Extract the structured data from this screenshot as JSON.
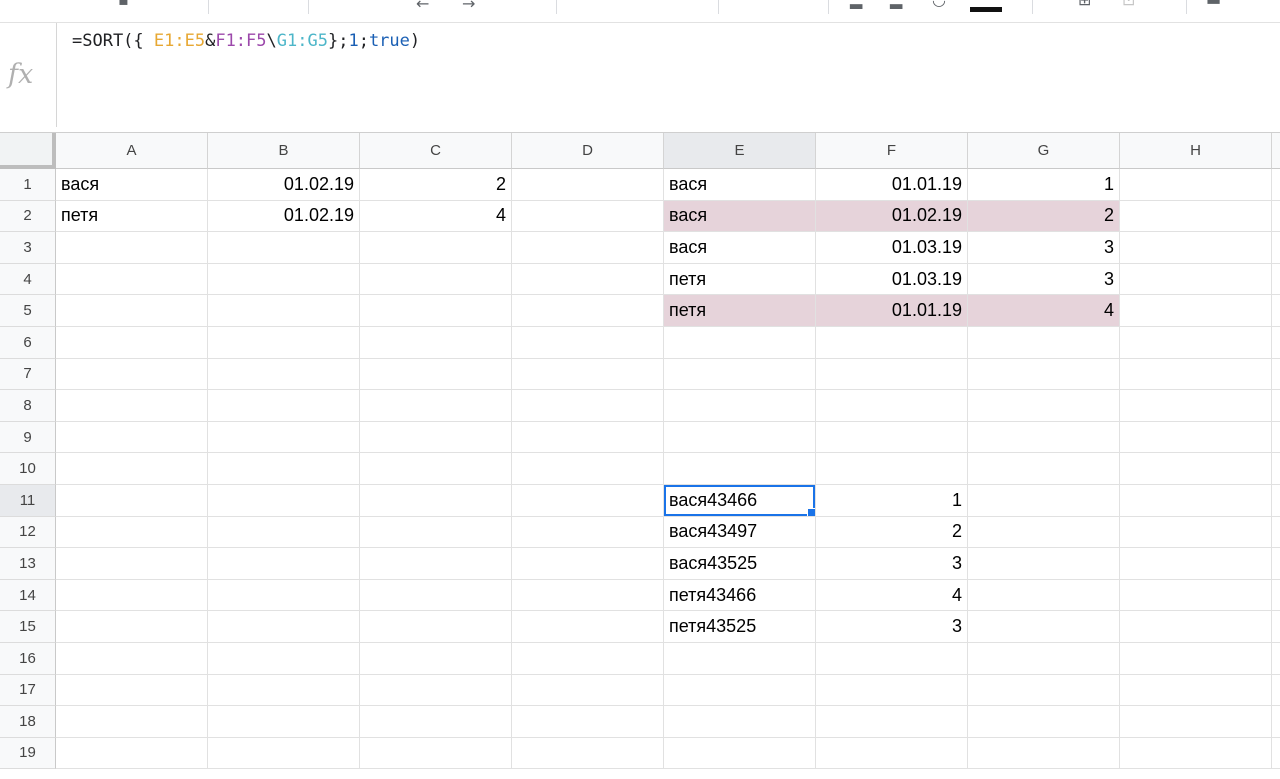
{
  "formula_bar": {
    "fx_label": "fx",
    "formula": {
      "prefix": "=SORT({ ",
      "range1": "E1:E5",
      "amp": "&",
      "range2": "F1:F5",
      "sep": "\\",
      "range3": "G1:G5",
      "close": "};",
      "arg1": "1",
      "semi": ";",
      "arg2": "true",
      "end": ")"
    }
  },
  "columns": [
    "A",
    "B",
    "C",
    "D",
    "E",
    "F",
    "G",
    "H"
  ],
  "active_column": "E",
  "active_row": 11,
  "row_count": 19,
  "highlight_color": "#e6d3da",
  "selection_color": "#1a73e8",
  "cells": [
    {
      "ref": "A1",
      "value": "вася",
      "type": "text"
    },
    {
      "ref": "B1",
      "value": "01.02.19",
      "type": "number"
    },
    {
      "ref": "C1",
      "value": "2",
      "type": "number"
    },
    {
      "ref": "E1",
      "value": "вася",
      "type": "text"
    },
    {
      "ref": "F1",
      "value": "01.01.19",
      "type": "number"
    },
    {
      "ref": "G1",
      "value": "1",
      "type": "number"
    },
    {
      "ref": "A2",
      "value": "петя",
      "type": "text"
    },
    {
      "ref": "B2",
      "value": "01.02.19",
      "type": "number"
    },
    {
      "ref": "C2",
      "value": "4",
      "type": "number"
    },
    {
      "ref": "E2",
      "value": "вася",
      "type": "text",
      "highlight": true
    },
    {
      "ref": "F2",
      "value": "01.02.19",
      "type": "number",
      "highlight": true
    },
    {
      "ref": "G2",
      "value": "2",
      "type": "number",
      "highlight": true
    },
    {
      "ref": "E3",
      "value": "вася",
      "type": "text"
    },
    {
      "ref": "F3",
      "value": "01.03.19",
      "type": "number"
    },
    {
      "ref": "G3",
      "value": "3",
      "type": "number"
    },
    {
      "ref": "E4",
      "value": "петя",
      "type": "text"
    },
    {
      "ref": "F4",
      "value": "01.03.19",
      "type": "number"
    },
    {
      "ref": "G4",
      "value": "3",
      "type": "number"
    },
    {
      "ref": "E5",
      "value": "петя",
      "type": "text",
      "highlight": true
    },
    {
      "ref": "F5",
      "value": "01.01.19",
      "type": "number",
      "highlight": true
    },
    {
      "ref": "G5",
      "value": "4",
      "type": "number",
      "highlight": true
    },
    {
      "ref": "E11",
      "value": "вася43466",
      "type": "text",
      "selected": true
    },
    {
      "ref": "F11",
      "value": "1",
      "type": "number"
    },
    {
      "ref": "E12",
      "value": "вася43497",
      "type": "text"
    },
    {
      "ref": "F12",
      "value": "2",
      "type": "number"
    },
    {
      "ref": "E13",
      "value": "вася43525",
      "type": "text"
    },
    {
      "ref": "F13",
      "value": "3",
      "type": "number"
    },
    {
      "ref": "E14",
      "value": "петя43466",
      "type": "text"
    },
    {
      "ref": "F14",
      "value": "4",
      "type": "number"
    },
    {
      "ref": "E15",
      "value": "петя43525",
      "type": "text"
    },
    {
      "ref": "F15",
      "value": "3",
      "type": "number"
    }
  ]
}
